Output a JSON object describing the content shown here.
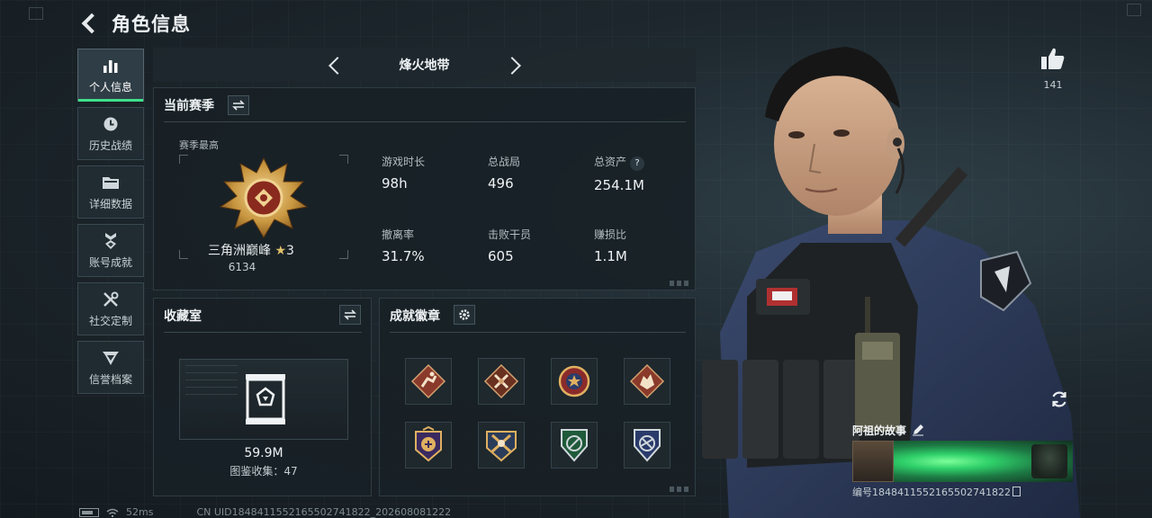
{
  "header": {
    "title": "角色信息"
  },
  "nav": {
    "items": [
      {
        "label": "个人信息",
        "icon": "bar-chart-icon",
        "active": true
      },
      {
        "label": "历史战绩",
        "icon": "clock-icon",
        "active": false
      },
      {
        "label": "详细数据",
        "icon": "folder-icon",
        "active": false
      },
      {
        "label": "账号成就",
        "icon": "medal-icon",
        "active": false
      },
      {
        "label": "社交定制",
        "icon": "tools-icon",
        "active": false
      },
      {
        "label": "信誉档案",
        "icon": "shield-icon",
        "active": false
      }
    ]
  },
  "mode": {
    "name": "烽火地带"
  },
  "season": {
    "title": "当前赛季",
    "best_label": "赛季最高",
    "rank_name": "三角洲巅峰",
    "rank_star": "★",
    "rank_level": "3",
    "rank_score": "6134",
    "stats": [
      {
        "label": "游戏时长",
        "value": "98h"
      },
      {
        "label": "总战局",
        "value": "496"
      },
      {
        "label": "总资产",
        "value": "254.1M"
      },
      {
        "label": "撤离率",
        "value": "31.7%"
      },
      {
        "label": "击败干员",
        "value": "605"
      },
      {
        "label": "赚损比",
        "value": "1.1M"
      }
    ],
    "help_glyph": "?"
  },
  "collection": {
    "title": "收藏室",
    "value": "59.9M",
    "count_text": "图鉴收集：47"
  },
  "badges": {
    "title": "成就徽章",
    "items": [
      "badge-1",
      "badge-2",
      "badge-3",
      "badge-4",
      "badge-5",
      "badge-6",
      "badge-7",
      "badge-8"
    ]
  },
  "likes": {
    "count": "141"
  },
  "story": {
    "title": "阿祖的故事",
    "id_text": "编号1848411552165502741822"
  },
  "statusbar": {
    "ping": "52ms",
    "uid": "CN UID1848411552165502741822_202608081222"
  },
  "colors": {
    "accent_green": "#3fe08a",
    "panel_bg": "#182126",
    "text_primary": "#eef2f4",
    "rank_gold": "#e0c06a"
  }
}
